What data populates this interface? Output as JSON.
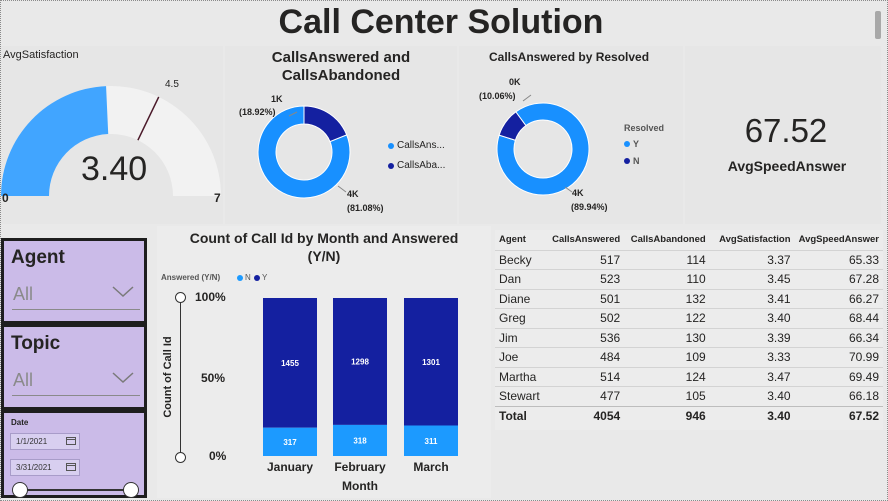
{
  "title": "Call Center Solution",
  "gauge": {
    "title": "AvgSatisfaction",
    "value_label": "3.40",
    "min_label": "0",
    "max_label": "7",
    "target_label": "4.5",
    "value": 3.4,
    "min": 0,
    "max": 7,
    "target": 4.5,
    "fill_color": "#41a5ff",
    "track_color": "#f2f2f2"
  },
  "donut1": {
    "title_line1": "CallsAnswered and",
    "title_line2": "CallsAbandoned",
    "slices": [
      {
        "name": "CallsAnswered",
        "value": 4054,
        "percent": 81.08,
        "color": "#1890ff",
        "label": "4K",
        "pct_label": "(81.08%)"
      },
      {
        "name": "CallsAbandoned",
        "value": 946,
        "percent": 18.92,
        "color": "#1420a0",
        "label": "1K",
        "pct_label": "(18.92%)"
      }
    ],
    "legend": [
      "CallsAns...",
      "CallsAba..."
    ]
  },
  "donut2": {
    "title": "CallsAnswered by Resolved",
    "legend_title": "Resolved",
    "slices": [
      {
        "name": "Y",
        "percent": 89.94,
        "color": "#1890ff",
        "label": "4K",
        "pct_label": "(89.94%)"
      },
      {
        "name": "N",
        "percent": 10.06,
        "color": "#1420a0",
        "label": "0K",
        "pct_label": "(10.06%)"
      }
    ],
    "legend": [
      "Y",
      "N"
    ]
  },
  "card": {
    "value": "67.52",
    "label": "AvgSpeedAnswer"
  },
  "slicers": {
    "agent": {
      "label": "Agent",
      "value": "All"
    },
    "topic": {
      "label": "Topic",
      "value": "All"
    },
    "date": {
      "label": "Date",
      "start": "1/1/2021",
      "end": "3/31/2021"
    }
  },
  "chart_data": {
    "type": "bar",
    "title_line1": "Count of Call Id by Month and Answered",
    "title_line2": "(Y/N)",
    "legend_title": "Answered (Y/N)",
    "legend": [
      "N",
      "Y"
    ],
    "xlabel": "Month",
    "ylabel": "Count of Call Id",
    "y_ticks": [
      "100%",
      "50%",
      "0%"
    ],
    "categories": [
      "January",
      "February",
      "March"
    ],
    "series": [
      {
        "name": "Y",
        "values": [
          317,
          318,
          311
        ],
        "color": "#1c9aff"
      },
      {
        "name": "N",
        "values": [
          1455,
          1298,
          1301
        ],
        "color": "#1420a0"
      }
    ]
  },
  "table": {
    "columns": [
      "Agent",
      "CallsAnswered",
      "CallsAbandoned",
      "AvgSatisfaction",
      "AvgSpeedAnswer"
    ],
    "rows": [
      [
        "Becky",
        "517",
        "114",
        "3.37",
        "65.33"
      ],
      [
        "Dan",
        "523",
        "110",
        "3.45",
        "67.28"
      ],
      [
        "Diane",
        "501",
        "132",
        "3.41",
        "66.27"
      ],
      [
        "Greg",
        "502",
        "122",
        "3.40",
        "68.44"
      ],
      [
        "Jim",
        "536",
        "130",
        "3.39",
        "66.34"
      ],
      [
        "Joe",
        "484",
        "109",
        "3.33",
        "70.99"
      ],
      [
        "Martha",
        "514",
        "124",
        "3.47",
        "69.49"
      ],
      [
        "Stewart",
        "477",
        "105",
        "3.40",
        "66.18"
      ]
    ],
    "total": [
      "Total",
      "4054",
      "946",
      "3.40",
      "67.52"
    ]
  }
}
